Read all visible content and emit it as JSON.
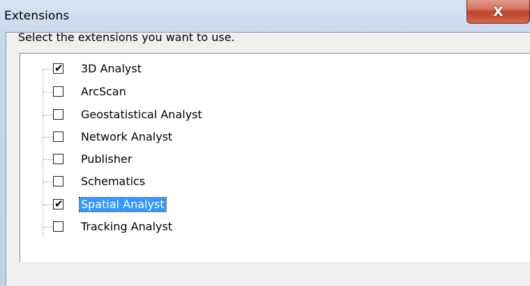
{
  "window": {
    "title": "Extensions",
    "close_glyph": "X"
  },
  "prompt": "Select the extensions you want to use.",
  "extensions": [
    {
      "label": "3D Analyst",
      "checked": true,
      "selected": false
    },
    {
      "label": "ArcScan",
      "checked": false,
      "selected": false
    },
    {
      "label": "Geostatistical Analyst",
      "checked": false,
      "selected": false
    },
    {
      "label": "Network Analyst",
      "checked": false,
      "selected": false
    },
    {
      "label": "Publisher",
      "checked": false,
      "selected": false
    },
    {
      "label": "Schematics",
      "checked": false,
      "selected": false
    },
    {
      "label": "Spatial Analyst",
      "checked": true,
      "selected": true
    },
    {
      "label": "Tracking Analyst",
      "checked": false,
      "selected": false
    }
  ],
  "check_glyph": "✔",
  "colors": {
    "selection": "#3399ff",
    "close_button": "#c0432c"
  }
}
